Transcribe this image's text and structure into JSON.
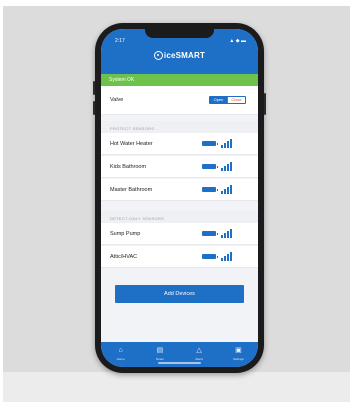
{
  "status_bar": {
    "time": "2:17",
    "icons": "▲ ◆ ▬"
  },
  "header": {
    "logo_text": "iceSMART"
  },
  "banner": {
    "text": "System OK",
    "color": "#6cc24a"
  },
  "valve": {
    "label": "Valve",
    "open_label": "Open",
    "close_label": "Close",
    "state": "Open"
  },
  "sections": [
    {
      "title": "PROTECT SENSORS",
      "sensors": [
        {
          "name": "Hot Water Heater",
          "signal_bars": 4
        },
        {
          "name": "Kids Bathroom",
          "signal_bars": 4
        },
        {
          "name": "Master Bathroom",
          "signal_bars": 4
        }
      ]
    },
    {
      "title": "DETECT-ONLY SENSORS",
      "sensors": [
        {
          "name": "Sump Pump",
          "signal_bars": 4
        },
        {
          "name": "Attic/HVAC",
          "signal_bars": 4
        }
      ]
    }
  ],
  "add_button": {
    "label": "Add Devices"
  },
  "tabs": [
    {
      "label": "Home",
      "icon": "home-icon"
    },
    {
      "label": "Notes",
      "icon": "notes-icon"
    },
    {
      "label": "Alerts",
      "icon": "bell-icon"
    },
    {
      "label": "Settings",
      "icon": "settings-icon"
    }
  ],
  "colors": {
    "primary": "#1e6fc6",
    "ok_green": "#6cc24a",
    "close_red": "#e04a4a"
  }
}
